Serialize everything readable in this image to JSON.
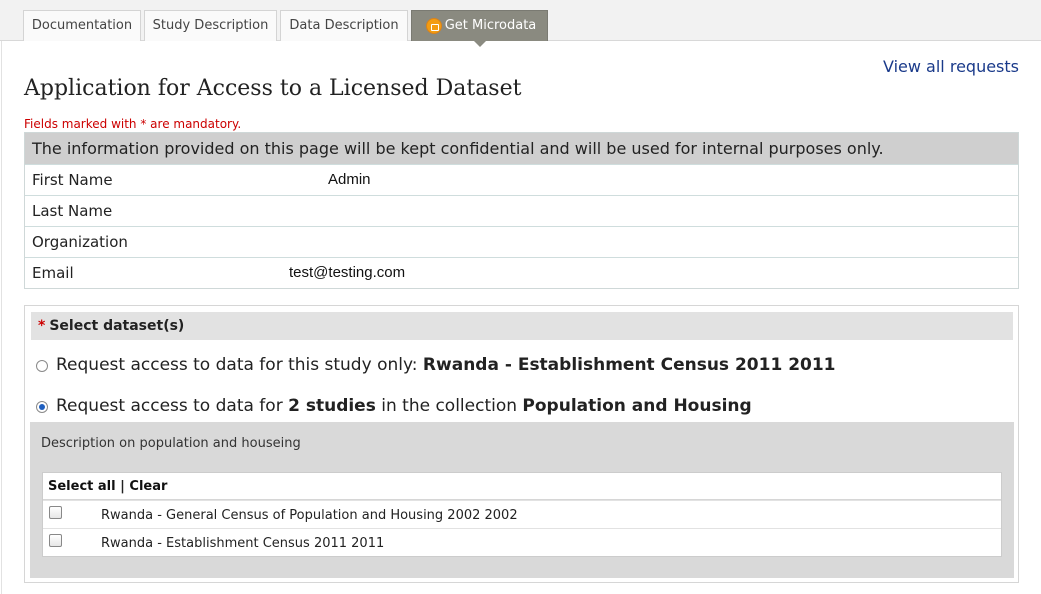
{
  "tabs": [
    {
      "label": "Documentation"
    },
    {
      "label": "Study Description"
    },
    {
      "label": "Data Description"
    },
    {
      "label": "Get Microdata",
      "icon": "lock-icon",
      "active": true
    }
  ],
  "view_all_requests": "View all requests",
  "page_title": "Application for Access to a Licensed Dataset",
  "mandatory_note": "Fields marked with * are mandatory.",
  "info": {
    "notice": "The information provided on this page will be kept confidential and will be used for internal purposes only.",
    "fields": [
      {
        "label": "First Name",
        "value": "Admin"
      },
      {
        "label": "Last Name",
        "value": ""
      },
      {
        "label": "Organization",
        "value": ""
      },
      {
        "label": "Email",
        "value": "test@testing.com"
      }
    ]
  },
  "dataset_selection": {
    "required_mark": "*",
    "heading": "Select dataset(s)",
    "option_study": {
      "prefix": "Request access to data for this study only: ",
      "study_name": "Rwanda - Establishment Census 2011 2011",
      "selected": false
    },
    "option_collection": {
      "prefix": "Request access to data for ",
      "count_text": "2 studies",
      "middle": " in the collection ",
      "collection_name": "Population and Housing",
      "selected": true
    },
    "collection_description": "Description on population and houseing",
    "select_all": "Select all",
    "separator": " | ",
    "clear": "Clear",
    "studies": [
      {
        "name": "Rwanda - General Census of Population and Housing 2002 2002",
        "checked": false
      },
      {
        "name": "Rwanda - Establishment Census 2011 2011",
        "checked": false
      }
    ]
  },
  "colors": {
    "active_tab": "#8a8a80",
    "link": "#1a3a8a",
    "mandatory": "#cc0000"
  }
}
